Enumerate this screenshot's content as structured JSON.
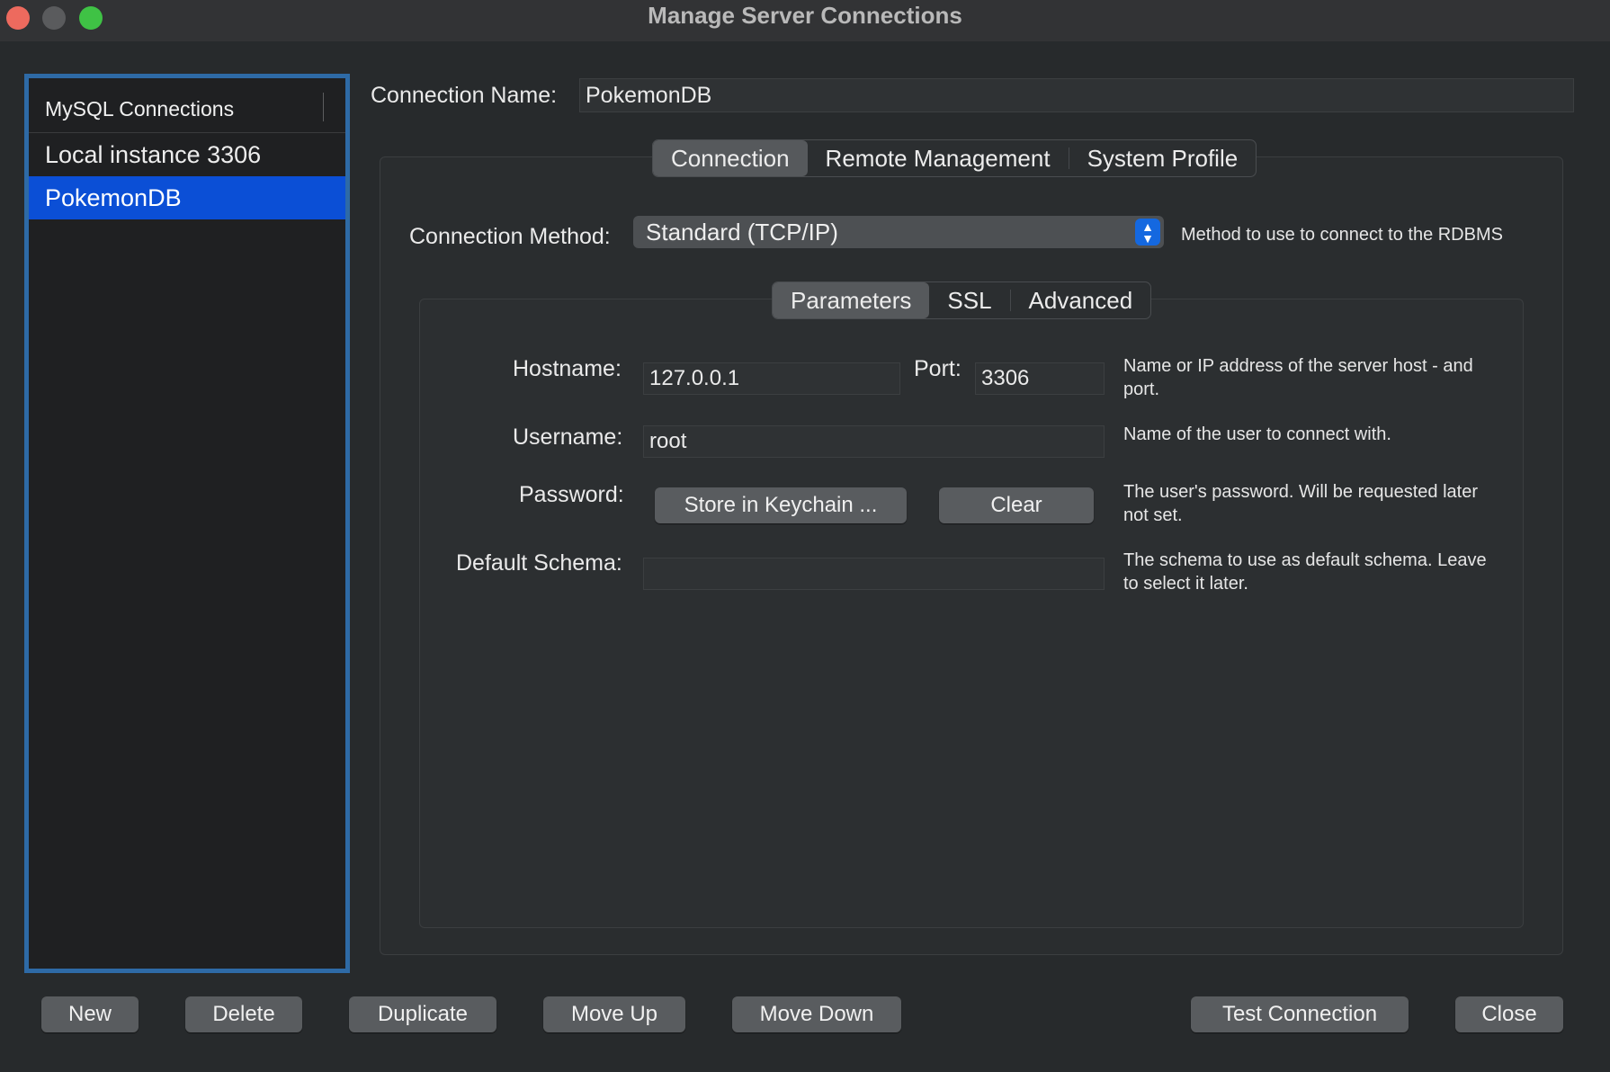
{
  "window": {
    "title": "Manage Server Connections"
  },
  "sidebar": {
    "header": "MySQL Connections",
    "items": [
      {
        "label": "Local instance 3306"
      },
      {
        "label": "PokemonDB"
      }
    ]
  },
  "connection_name": {
    "label": "Connection Name:",
    "value": "PokemonDB"
  },
  "main_tabs": [
    {
      "label": "Connection"
    },
    {
      "label": "Remote Management"
    },
    {
      "label": "System Profile"
    }
  ],
  "method": {
    "label": "Connection Method:",
    "value": "Standard (TCP/IP)",
    "hint": "Method to use to connect to the RDBMS"
  },
  "sub_tabs": [
    {
      "label": "Parameters"
    },
    {
      "label": "SSL"
    },
    {
      "label": "Advanced"
    }
  ],
  "params": {
    "hostname": {
      "label": "Hostname:",
      "value": "127.0.0.1"
    },
    "port": {
      "label": "Port:",
      "value": "3306"
    },
    "host_hint_1": "Name or IP address of the server host - and",
    "host_hint_2": "port.",
    "username": {
      "label": "Username:",
      "value": "root",
      "hint": "Name of the user to connect with."
    },
    "password": {
      "label": "Password:",
      "store_button": "Store in Keychain ...",
      "clear_button": "Clear",
      "hint_1": "The user's password. Will be requested later",
      "hint_2": "not set."
    },
    "schema": {
      "label": "Default Schema:",
      "value": "",
      "hint_1": "The schema to use as default schema. Leave",
      "hint_2": "to select it later."
    }
  },
  "footer": {
    "new": "New",
    "delete": "Delete",
    "duplicate": "Duplicate",
    "move_up": "Move Up",
    "move_down": "Move Down",
    "test": "Test Connection",
    "close": "Close"
  }
}
